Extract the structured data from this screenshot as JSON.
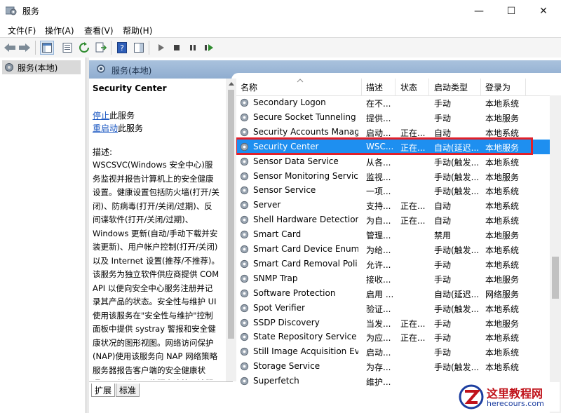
{
  "window": {
    "title": "服务",
    "minimize": "—",
    "maximize": "☐",
    "close": "✕"
  },
  "menu": [
    "文件(F)",
    "操作(A)",
    "查看(V)",
    "帮助(H)"
  ],
  "tree": {
    "root_label": "服务(本地)"
  },
  "pane_header": "服务(本地)",
  "description": {
    "service_name": "Security Center",
    "stop_link": "停止",
    "stop_suffix": "此服务",
    "restart_link": "重启动",
    "restart_suffix": "此服务",
    "label": "描述:",
    "text": "WSCSVC(Windows 安全中心)服务监视并报告计算机上的安全健康设置。健康设置包括防火墙(打开/关闭)、防病毒(打开/关闭/过期)、反间谍软件(打开/关闭/过期)、Windows 更新(自动/手动下载并安装更新)、用户帐户控制(打开/关闭)以及 Internet 设置(推荐/不推荐)。该服务为独立软件供应商提供 COM API 以便向安全中心服务注册并记录其产品的状态。安全性与维护 UI 使用该服务在\"安全性与维护\"控制面板中提供 systray 警报和安全健康状况的图形视图。网络访问保护(NAP)使用该服务向 NAP 网络策略服务器报告客户端的安全健康状况，以便进行网络隔离决策。该服务还提供一个公共"
  },
  "bottom_tabs": [
    "扩展",
    "标准"
  ],
  "columns": [
    "名称",
    "描述",
    "状态",
    "启动类型",
    "登录为"
  ],
  "rows": [
    {
      "name": "Secondary Logon",
      "desc": "在不...",
      "status": "",
      "startup": "手动",
      "logon": "本地系统"
    },
    {
      "name": "Secure Socket Tunneling ...",
      "desc": "提供...",
      "status": "",
      "startup": "手动",
      "logon": "本地服务"
    },
    {
      "name": "Security Accounts Manag...",
      "desc": "启动...",
      "status": "正在...",
      "startup": "自动",
      "logon": "本地系统"
    },
    {
      "name": "Security Center",
      "desc": "WSC...",
      "status": "正在...",
      "startup": "自动(延迟...",
      "logon": "本地服务"
    },
    {
      "name": "Sensor Data Service",
      "desc": "从各...",
      "status": "",
      "startup": "手动(触发...",
      "logon": "本地系统"
    },
    {
      "name": "Sensor Monitoring Service",
      "desc": "监视...",
      "status": "",
      "startup": "手动(触发...",
      "logon": "本地服务"
    },
    {
      "name": "Sensor Service",
      "desc": "一项...",
      "status": "",
      "startup": "手动(触发...",
      "logon": "本地系统"
    },
    {
      "name": "Server",
      "desc": "支持...",
      "status": "正在...",
      "startup": "自动",
      "logon": "本地系统"
    },
    {
      "name": "Shell Hardware Detection",
      "desc": "为自...",
      "status": "正在...",
      "startup": "自动",
      "logon": "本地系统"
    },
    {
      "name": "Smart Card",
      "desc": "管理...",
      "status": "",
      "startup": "禁用",
      "logon": "本地服务"
    },
    {
      "name": "Smart Card Device Enum...",
      "desc": "为给...",
      "status": "",
      "startup": "手动(触发...",
      "logon": "本地系统"
    },
    {
      "name": "Smart Card Removal Poli...",
      "desc": "允许...",
      "status": "",
      "startup": "手动",
      "logon": "本地系统"
    },
    {
      "name": "SNMP Trap",
      "desc": "接收...",
      "status": "",
      "startup": "手动",
      "logon": "本地服务"
    },
    {
      "name": "Software Protection",
      "desc": "启用 ...",
      "status": "",
      "startup": "自动(延迟...",
      "logon": "网络服务"
    },
    {
      "name": "Spot Verifier",
      "desc": "验证...",
      "status": "",
      "startup": "手动(触发...",
      "logon": "本地系统"
    },
    {
      "name": "SSDP Discovery",
      "desc": "当发...",
      "status": "正在...",
      "startup": "手动",
      "logon": "本地服务"
    },
    {
      "name": "State Repository Service",
      "desc": "为应...",
      "status": "正在...",
      "startup": "手动",
      "logon": "本地系统"
    },
    {
      "name": "Still Image Acquisition Ev...",
      "desc": "启动...",
      "status": "",
      "startup": "手动",
      "logon": "本地系统"
    },
    {
      "name": "Storage Service",
      "desc": "为存...",
      "status": "",
      "startup": "手动(触发...",
      "logon": "本地系统"
    },
    {
      "name": "Superfetch",
      "desc": "维护...",
      "status": "",
      "startup": "",
      "logon": ""
    }
  ],
  "selected_row": "Security Center",
  "watermark": {
    "cn": "这里教程网",
    "en": "herecours.com"
  },
  "colors": {
    "selection": "#1e8ff0",
    "highlight_box": "#e0202a",
    "link": "#1a57c2"
  }
}
